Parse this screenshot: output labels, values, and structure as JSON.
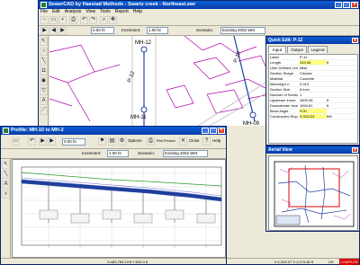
{
  "main": {
    "title": "SewerCAD by Haestad Methods - Swartz creek - Northeast.swr",
    "menu": [
      "File",
      "Edit",
      "Analysis",
      "View",
      "Tools",
      "Report",
      "Help"
    ],
    "scale_value": "0.00 hr",
    "increment_label": "Increment:",
    "increment_value": "1.00 hr",
    "scenario_label": "Scenario:",
    "scenario_value": "Existing 2002 Wet"
  },
  "plan": {
    "labels": [
      "MH-12",
      "P-12",
      "MH-11",
      "P-10",
      "MH-09"
    ]
  },
  "quick_edit": {
    "title": "Quick Edit: P-12",
    "tabs": [
      "Input",
      "Output",
      "Legend"
    ],
    "rows": [
      {
        "k": "Label",
        "v": "P-12",
        "u": ""
      },
      {
        "k": "Length",
        "v": "249.06",
        "u": "ft"
      },
      {
        "k": "User Defined Len",
        "v": "false",
        "u": ""
      },
      {
        "k": "Section Shape",
        "v": "Circular",
        "u": ""
      },
      {
        "k": "Material",
        "v": "Concrete",
        "u": ""
      },
      {
        "k": "Manning's n",
        "v": "0.013",
        "u": ""
      },
      {
        "k": "Section Size",
        "v": "8 inch",
        "u": ""
      },
      {
        "k": "Number of Sectio",
        "v": "1",
        "u": ""
      },
      {
        "k": "Upstream Invert",
        "v": "1600.06",
        "u": "ft"
      },
      {
        "k": "Downstream Inve",
        "v": "1594.81",
        "u": "ft"
      },
      {
        "k": "Bend Angle",
        "v": "0.00",
        "u": ""
      },
      {
        "k": "Constructed Slop",
        "v": "0.021133",
        "u": "ft/ft"
      }
    ]
  },
  "aerial": {
    "title": "Aerial View"
  },
  "profile": {
    "title": "Profile: MH-10 to MH-2",
    "time_value": "0.00 hr",
    "increment_label": "Increment:",
    "increment_value": "1.00 hr",
    "scenario_label": "Scenario:",
    "scenario_value": "Existing 2002 Wet",
    "options_label": "Options",
    "print_label": "Print Preview",
    "close_label": "Close",
    "help_label": "Help",
    "status_text": "X:483,763.24 ft Y:810.0 ft"
  },
  "main_status": {
    "coords": "X:1,532.07 Y:1,273.46 ft",
    "units": "US",
    "state": "COMPUTE"
  },
  "colors": {
    "title_blue": "#0a3ca6",
    "pipe_blue": "#1f3f9f",
    "parcel_magenta": "#b000b0",
    "hgl_green": "#2a9a2a",
    "highlight_yellow": "#ffff80"
  }
}
